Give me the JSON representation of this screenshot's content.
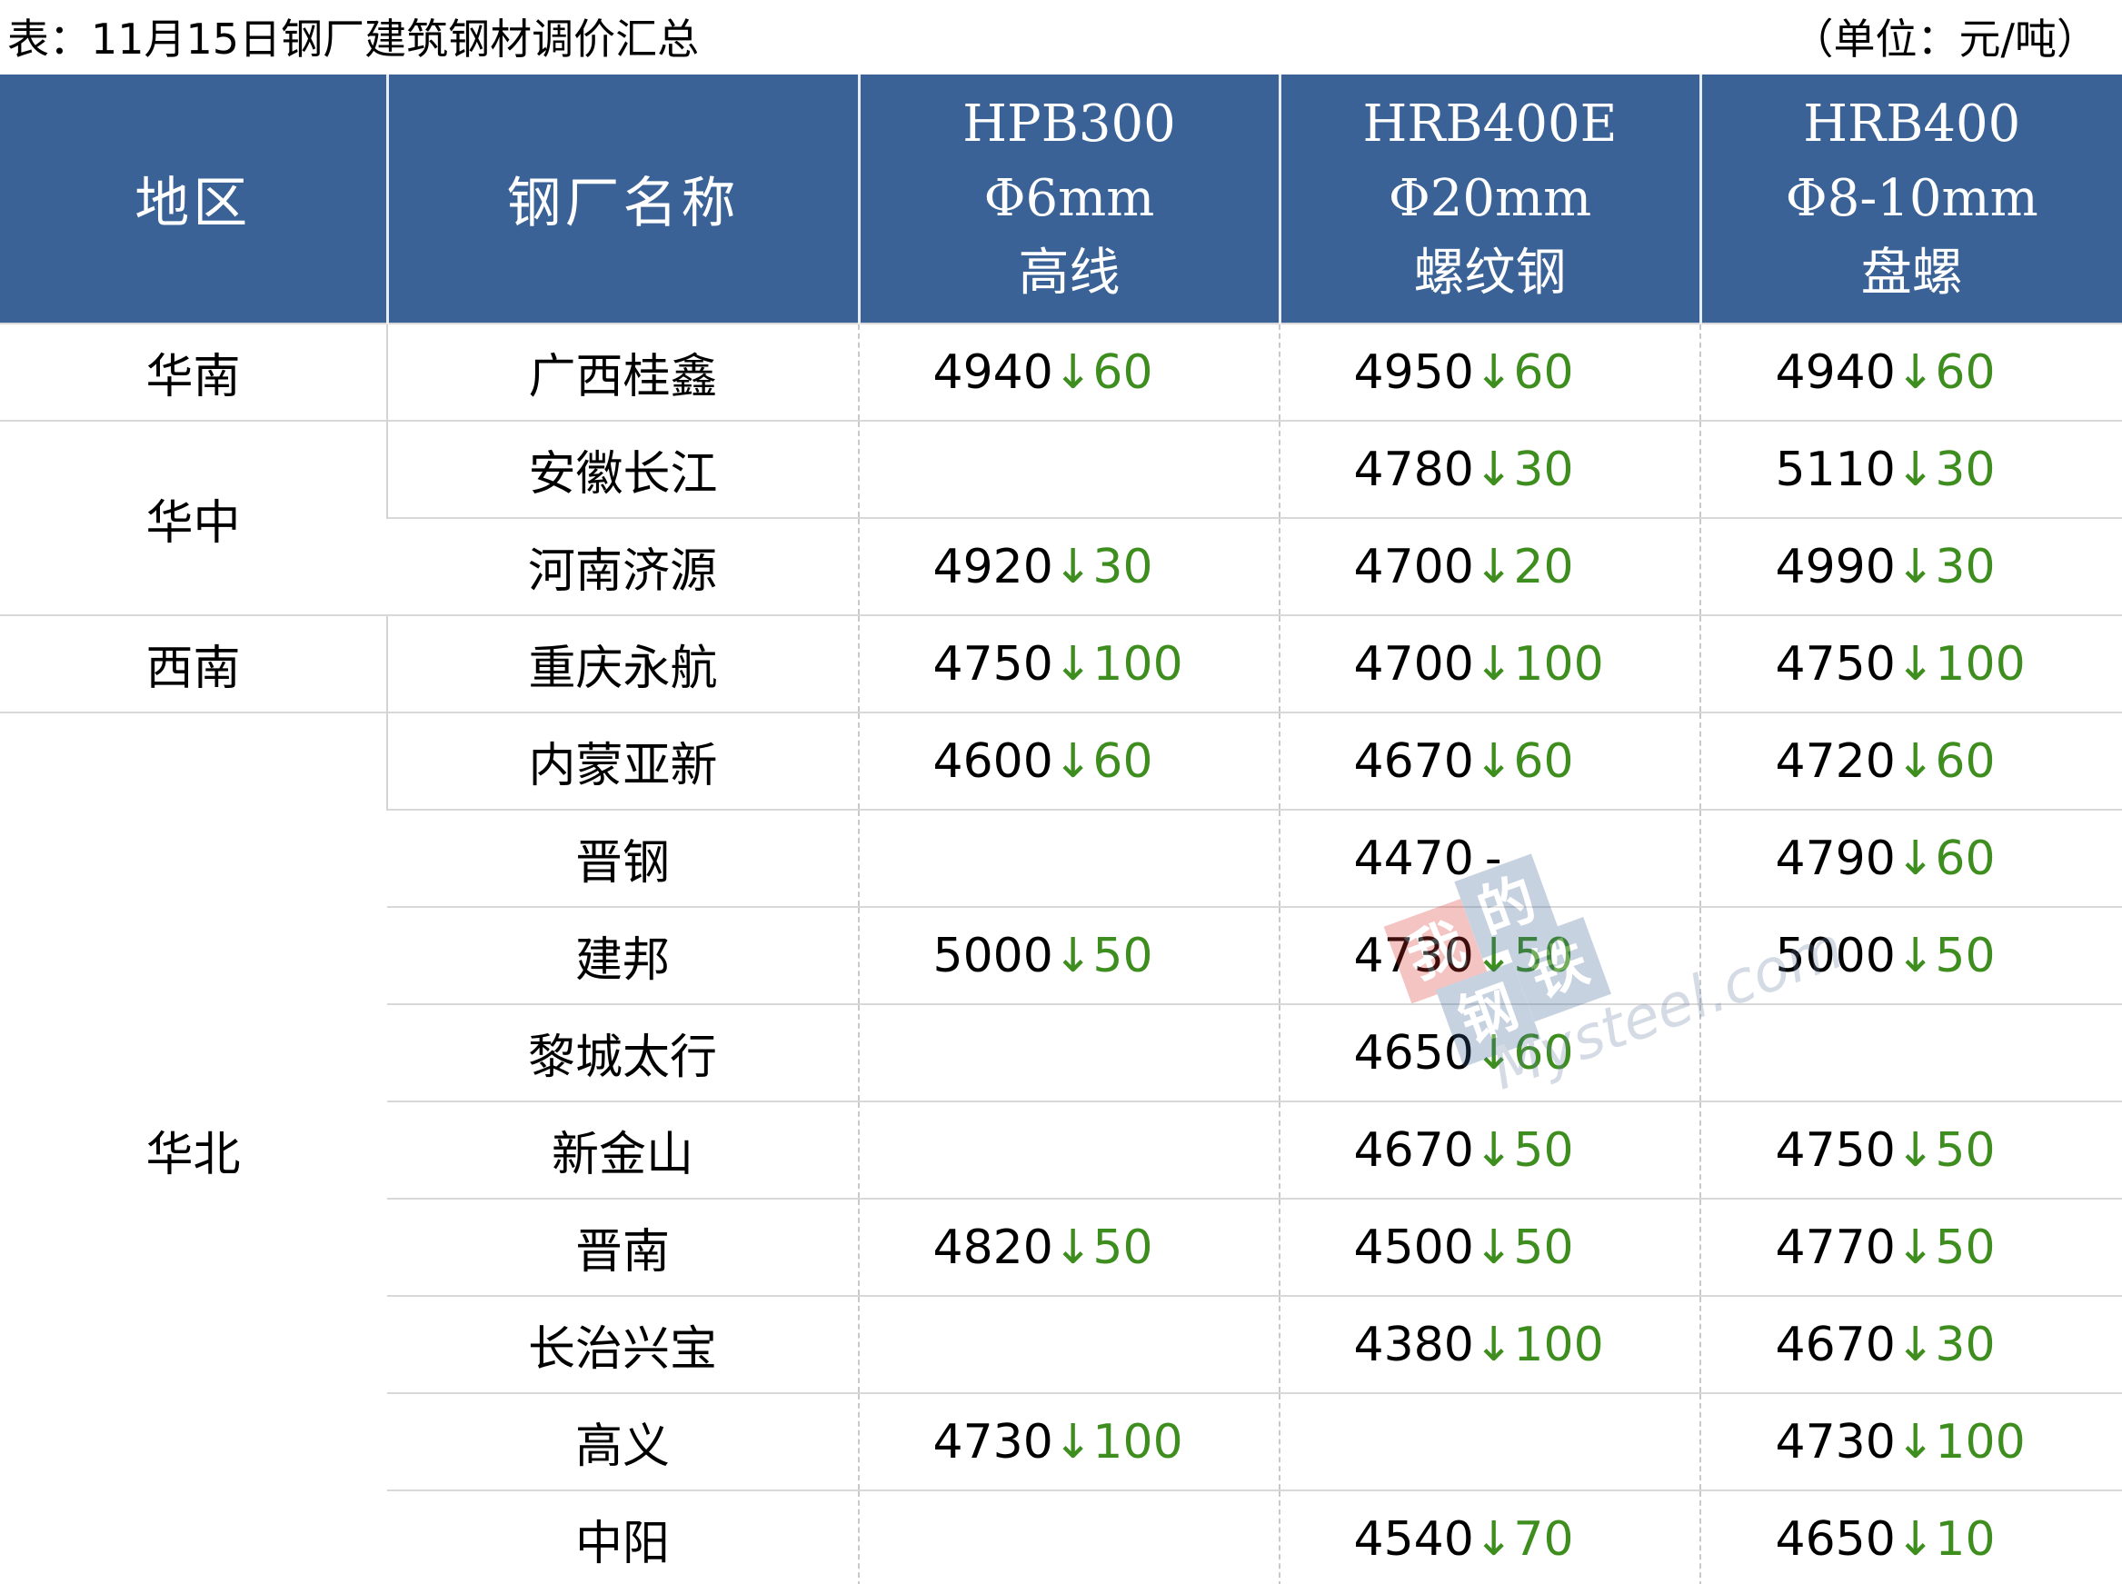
{
  "caption": {
    "title": "表：11月15日钢厂建筑钢材调价汇总",
    "unit": "（单位：元/吨）"
  },
  "header": {
    "region": "地区",
    "mill": "钢厂名称",
    "products": [
      {
        "grade": "HPB300",
        "spec": "Φ6mm",
        "name": "高线"
      },
      {
        "grade": "HRB400E",
        "spec": "Φ20mm",
        "name": "螺纹钢"
      },
      {
        "grade": "HRB400",
        "spec": "Φ8-10mm",
        "name": "盘螺"
      }
    ]
  },
  "regions": {
    "south": "华南",
    "central": "华中",
    "southwest": "西南",
    "north": "华北"
  },
  "rows": [
    {
      "mill": "广西桂鑫",
      "cells": [
        {
          "price": "4940",
          "arrow": "↓",
          "change": "60"
        },
        {
          "price": "4950",
          "arrow": "↓",
          "change": "60"
        },
        {
          "price": "4940",
          "arrow": "↓",
          "change": "60"
        }
      ]
    },
    {
      "mill": "安徽长江",
      "cells": [
        {
          "price": "",
          "arrow": "",
          "change": ""
        },
        {
          "price": "4780",
          "arrow": "↓",
          "change": "30"
        },
        {
          "price": "5110",
          "arrow": "↓",
          "change": "30"
        }
      ]
    },
    {
      "mill": "河南济源",
      "cells": [
        {
          "price": "4920",
          "arrow": "↓",
          "change": "30"
        },
        {
          "price": "4700",
          "arrow": "↓",
          "change": "20"
        },
        {
          "price": "4990",
          "arrow": "↓",
          "change": "30"
        }
      ]
    },
    {
      "mill": "重庆永航",
      "cells": [
        {
          "price": "4750",
          "arrow": "↓",
          "change": "100"
        },
        {
          "price": "4700",
          "arrow": "↓",
          "change": "100"
        },
        {
          "price": "4750",
          "arrow": "↓",
          "change": "100"
        }
      ]
    },
    {
      "mill": "内蒙亚新",
      "cells": [
        {
          "price": "4600",
          "arrow": "↓",
          "change": "60"
        },
        {
          "price": "4670",
          "arrow": "↓",
          "change": "60"
        },
        {
          "price": "4720",
          "arrow": "↓",
          "change": "60"
        }
      ]
    },
    {
      "mill": "晋钢",
      "cells": [
        {
          "price": "",
          "arrow": "",
          "change": ""
        },
        {
          "price": "4470",
          "arrow": "",
          "change": "-"
        },
        {
          "price": "4790",
          "arrow": "↓",
          "change": "60"
        }
      ]
    },
    {
      "mill": "建邦",
      "cells": [
        {
          "price": "5000",
          "arrow": "↓",
          "change": "50"
        },
        {
          "price": "4730",
          "arrow": "↓",
          "change": "50"
        },
        {
          "price": "5000",
          "arrow": "↓",
          "change": "50"
        }
      ]
    },
    {
      "mill": "黎城太行",
      "cells": [
        {
          "price": "",
          "arrow": "",
          "change": ""
        },
        {
          "price": "4650",
          "arrow": "↓",
          "change": "60"
        },
        {
          "price": "",
          "arrow": "",
          "change": ""
        }
      ]
    },
    {
      "mill": "新金山",
      "cells": [
        {
          "price": "",
          "arrow": "",
          "change": ""
        },
        {
          "price": "4670",
          "arrow": "↓",
          "change": "50"
        },
        {
          "price": "4750",
          "arrow": "↓",
          "change": "50"
        }
      ]
    },
    {
      "mill": "晋南",
      "cells": [
        {
          "price": "4820",
          "arrow": "↓",
          "change": "50"
        },
        {
          "price": "4500",
          "arrow": "↓",
          "change": "50"
        },
        {
          "price": "4770",
          "arrow": "↓",
          "change": "50"
        }
      ]
    },
    {
      "mill": "长治兴宝",
      "cells": [
        {
          "price": "",
          "arrow": "",
          "change": ""
        },
        {
          "price": "4380",
          "arrow": "↓",
          "change": "100"
        },
        {
          "price": "4670",
          "arrow": "↓",
          "change": "30"
        }
      ]
    },
    {
      "mill": "高义",
      "cells": [
        {
          "price": "4730",
          "arrow": "↓",
          "change": "100"
        },
        {
          "price": "",
          "arrow": "",
          "change": ""
        },
        {
          "price": "4730",
          "arrow": "↓",
          "change": "100"
        }
      ]
    },
    {
      "mill": "中阳",
      "cells": [
        {
          "price": "",
          "arrow": "",
          "change": ""
        },
        {
          "price": "4540",
          "arrow": "↓",
          "change": "70"
        },
        {
          "price": "4650",
          "arrow": "↓",
          "change": "10"
        }
      ]
    }
  ],
  "watermark": {
    "chars": [
      "我",
      "的",
      "钢",
      "铁"
    ],
    "text": "Mysteel.com"
  },
  "colors": {
    "header_bg": "#3a6296",
    "decrease": "#3e8e1f"
  }
}
